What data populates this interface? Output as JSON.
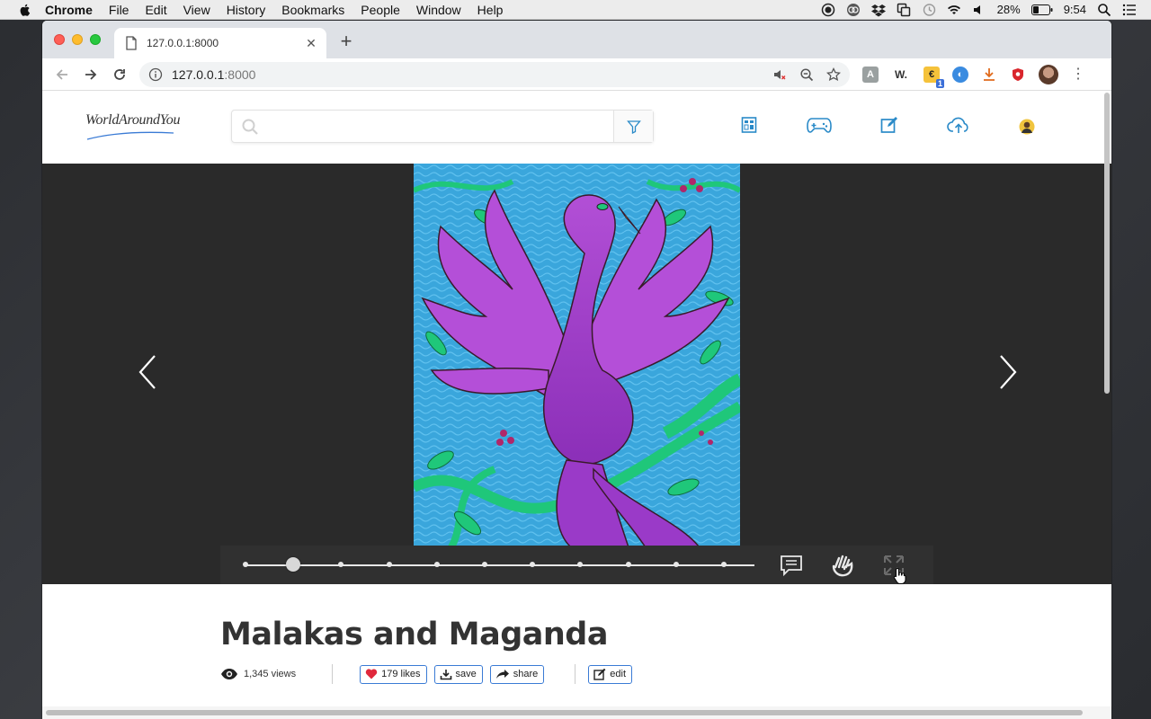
{
  "menubar": {
    "app": "Chrome",
    "items": [
      "File",
      "Edit",
      "View",
      "History",
      "Bookmarks",
      "People",
      "Window",
      "Help"
    ],
    "battery": "28%",
    "time": "9:54"
  },
  "browser": {
    "tab_title": "127.0.0.1:8000",
    "url_host": "127.0.0.1",
    "url_port": ":8000",
    "extension_badge": "1",
    "ext_w_label": "W."
  },
  "site": {
    "logo_text": "WorldAroundYou",
    "search_placeholder": "",
    "nav_icons": [
      "gallery-icon",
      "gamepad-icon",
      "edit-icon",
      "cloud-upload-icon",
      "user-avatar"
    ]
  },
  "viewer": {
    "slide_count": 11,
    "current_slide": 2,
    "controls": [
      "comment-icon",
      "sign-language-icon",
      "fullscreen-icon"
    ]
  },
  "artwork": {
    "title": "Malakas and Maganda",
    "views": "1,345 views",
    "likes_label": "179 likes",
    "save_label": "save",
    "share_label": "share",
    "edit_label": "edit"
  },
  "colors": {
    "viewer_bg": "#2a2a2a",
    "control_bar": "#303030",
    "accent_blue": "#3a7bd5",
    "heart": "#e0283c",
    "nav_icon": "#2a8ac8"
  }
}
